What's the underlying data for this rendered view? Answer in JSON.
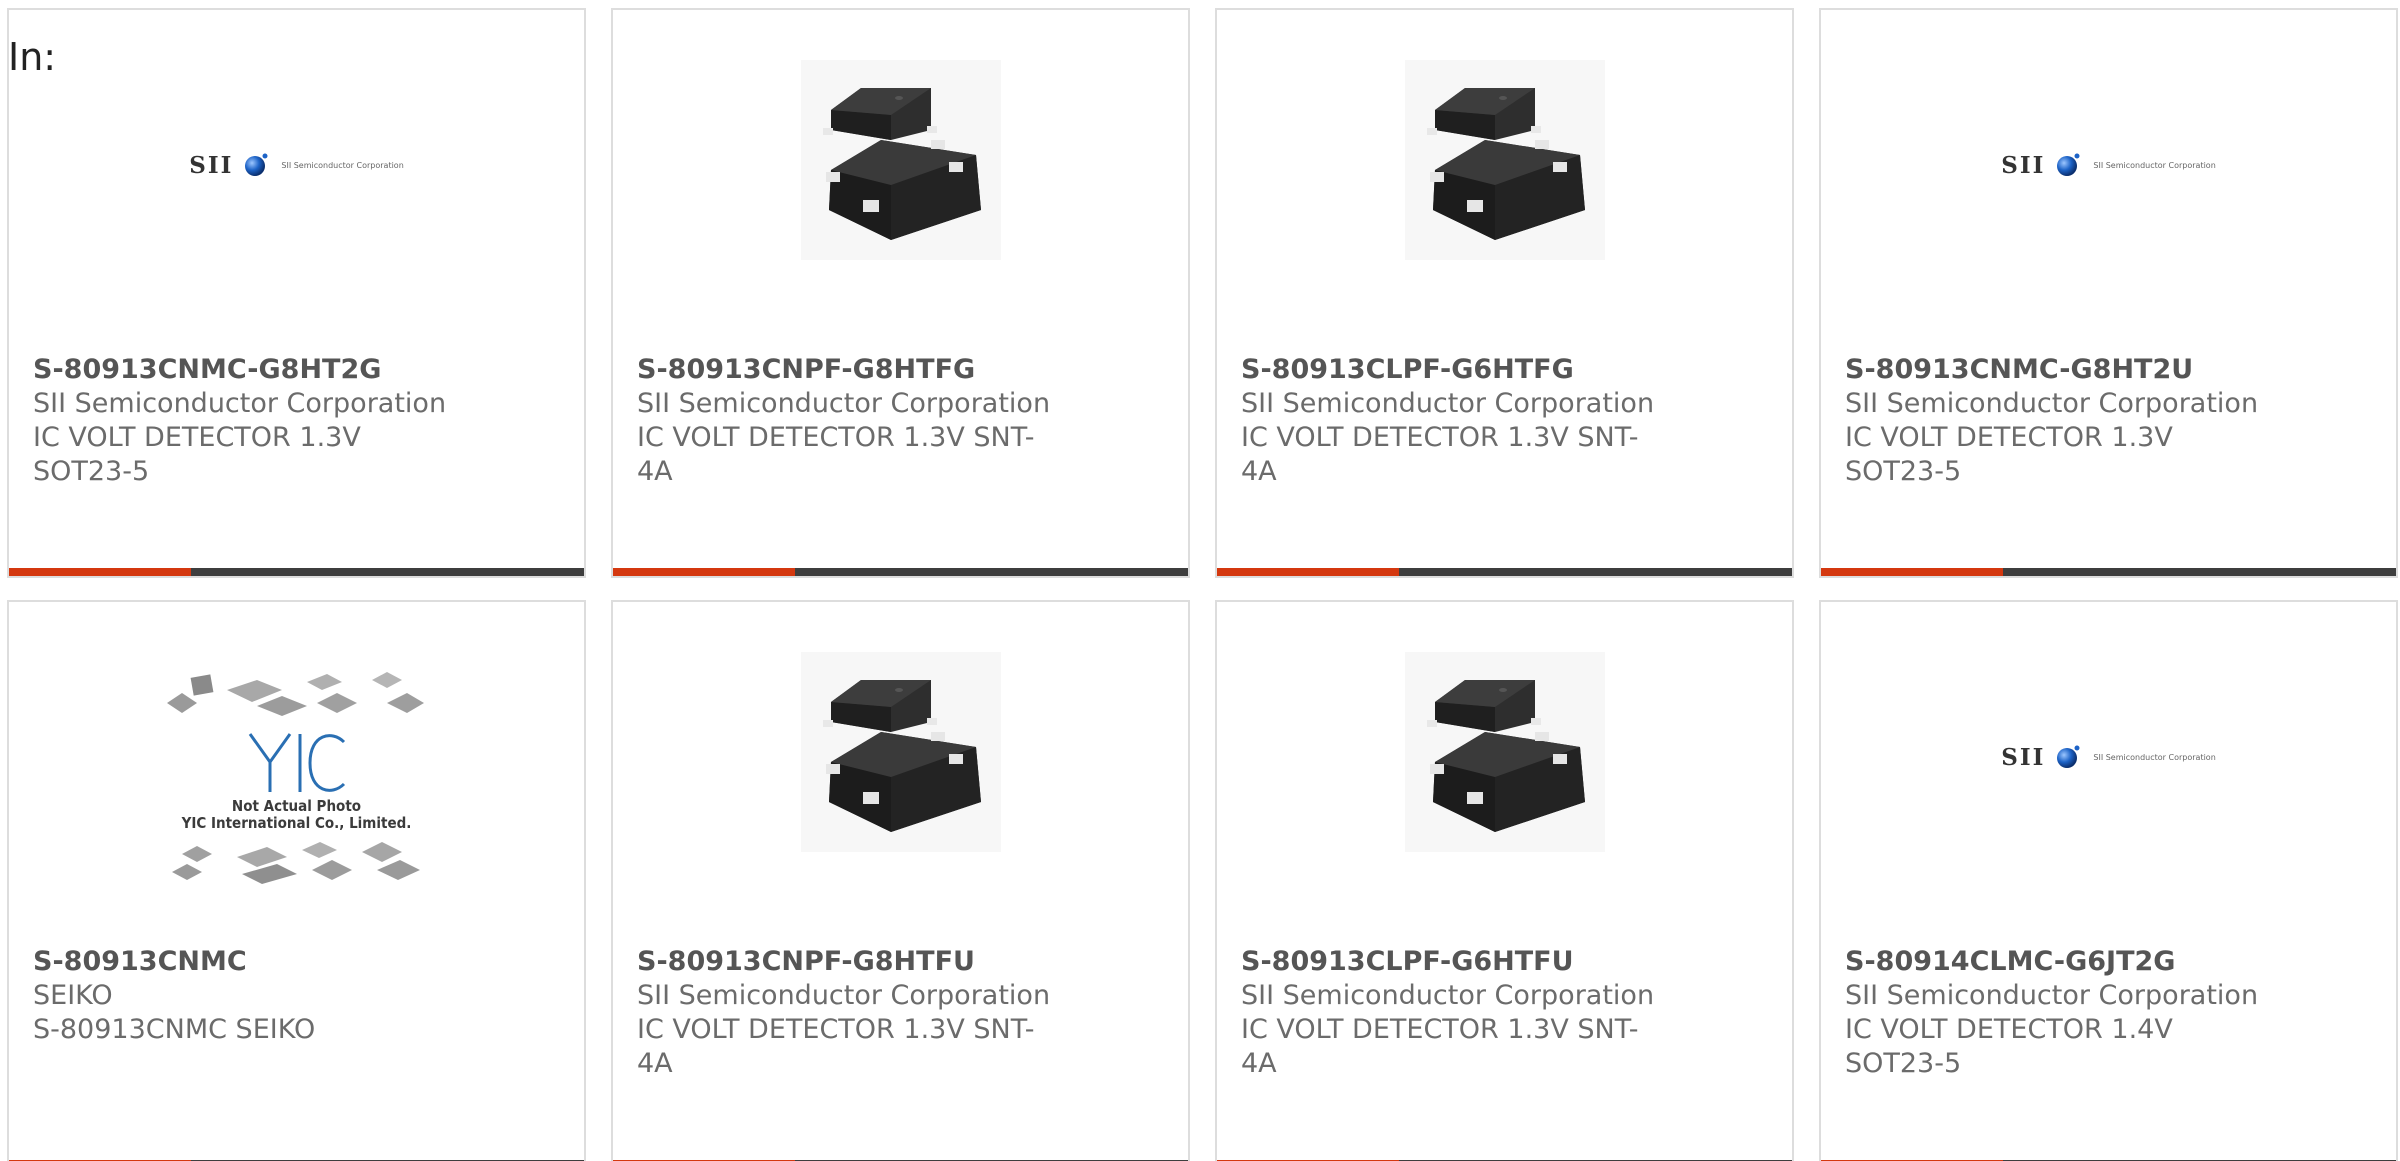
{
  "header": {
    "in_label": "In:"
  },
  "colors": {
    "accent_orange": "#d4380f",
    "accent_dark": "#3e3e3e",
    "card_border": "#dddddd",
    "sii_blue": "#1d63c7"
  },
  "products": [
    {
      "part_number": "S-80913CNMC-G8HT2G",
      "manufacturer": "SII Semiconductor Corporation",
      "description": "IC VOLT DETECTOR 1.3V SOT23-5",
      "image": "sii-logo",
      "logo_text": "SII",
      "logo_subtext": "SII Semiconductor Corporation"
    },
    {
      "part_number": "S-80913CNPF-G8HTFG",
      "manufacturer": "SII Semiconductor Corporation",
      "description": "IC VOLT DETECTOR 1.3V SNT-4A",
      "image": "snt-4a-package-photo"
    },
    {
      "part_number": "S-80913CLPF-G6HTFG",
      "manufacturer": "SII Semiconductor Corporation",
      "description": "IC VOLT DETECTOR 1.3V SNT-4A",
      "image": "snt-4a-package-photo"
    },
    {
      "part_number": "S-80913CNMC-G8HT2U",
      "manufacturer": "SII Semiconductor Corporation",
      "description": "IC VOLT DETECTOR 1.3V SOT23-5",
      "image": "sii-logo",
      "logo_text": "SII",
      "logo_subtext": "SII Semiconductor Corporation"
    },
    {
      "part_number": "S-80913CNMC",
      "manufacturer": "SEIKO",
      "description": "S-80913CNMC SEIKO",
      "image": "yic-placeholder",
      "placeholder_line1": "Not Actual Photo",
      "placeholder_line2": "YIC International Co., Limited."
    },
    {
      "part_number": "S-80913CNPF-G8HTFU",
      "manufacturer": "SII Semiconductor Corporation",
      "description": "IC VOLT DETECTOR 1.3V SNT-4A",
      "image": "snt-4a-package-photo"
    },
    {
      "part_number": "S-80913CLPF-G6HTFU",
      "manufacturer": "SII Semiconductor Corporation",
      "description": "IC VOLT DETECTOR 1.3V SNT-4A",
      "image": "snt-4a-package-photo"
    },
    {
      "part_number": "S-80914CLMC-G6JT2G",
      "manufacturer": "SII Semiconductor Corporation",
      "description": "IC VOLT DETECTOR 1.4V SOT23-5",
      "image": "sii-logo",
      "logo_text": "SII",
      "logo_subtext": "SII Semiconductor Corporation"
    }
  ]
}
